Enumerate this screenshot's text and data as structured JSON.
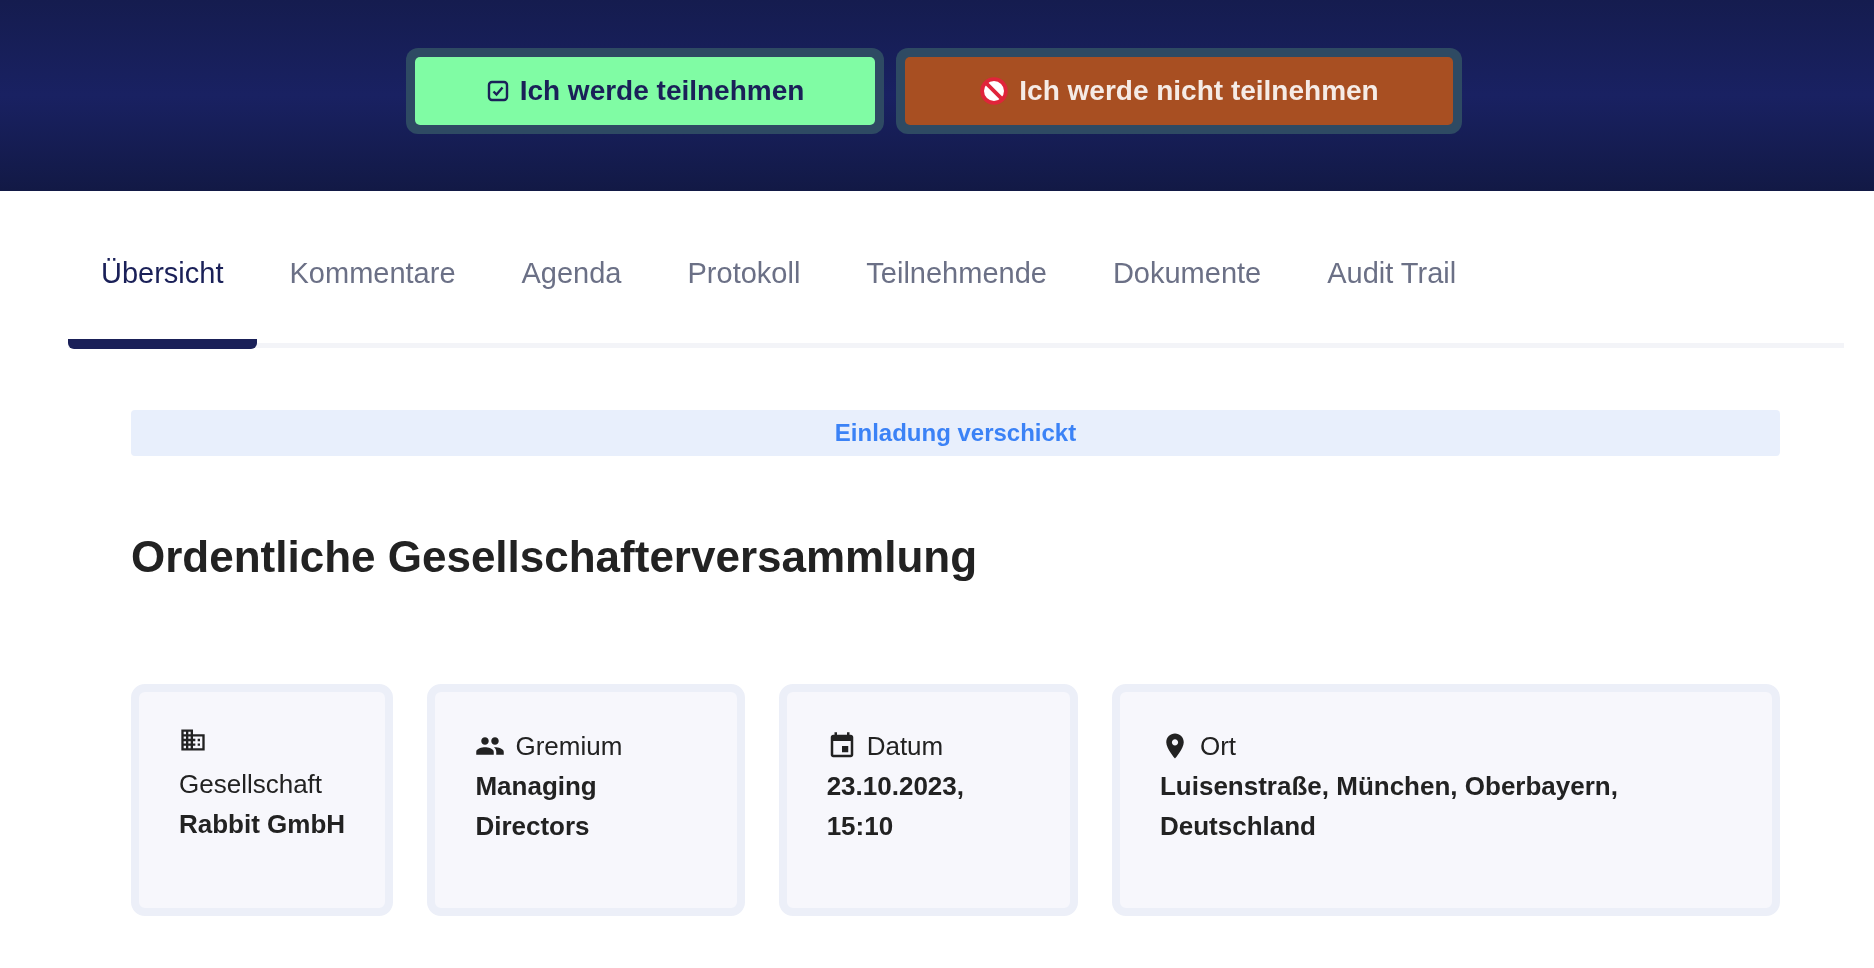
{
  "header": {
    "buttons": [
      {
        "kind": "accept",
        "label": "Ich werde teilnehmen"
      },
      {
        "kind": "decline",
        "label": "Ich werde nicht teilnehmen"
      }
    ]
  },
  "tabs": [
    {
      "label": "Übersicht",
      "selected": true
    },
    {
      "label": "Kommentare",
      "selected": false
    },
    {
      "label": "Agenda",
      "selected": false
    },
    {
      "label": "Protokoll",
      "selected": false
    },
    {
      "label": "Teilnehmende",
      "selected": false
    },
    {
      "label": "Dokumente",
      "selected": false
    },
    {
      "label": "Audit Trail",
      "selected": false
    }
  ],
  "status_banner": "Einladung verschickt",
  "title": "Ordentliche Gesellschafterversammlung",
  "cards": [
    {
      "kind": "company",
      "label": "Gesellschaft",
      "value": "Rabbit GmbH"
    },
    {
      "kind": "committee",
      "label": "Gremium",
      "value": "Managing Directors"
    },
    {
      "kind": "date",
      "label": "Datum",
      "value": "23.10.2023, 15:10"
    },
    {
      "kind": "location",
      "label": "Ort",
      "value": "Luisenstraße, München, Oberbayern, Deutschland"
    }
  ]
}
